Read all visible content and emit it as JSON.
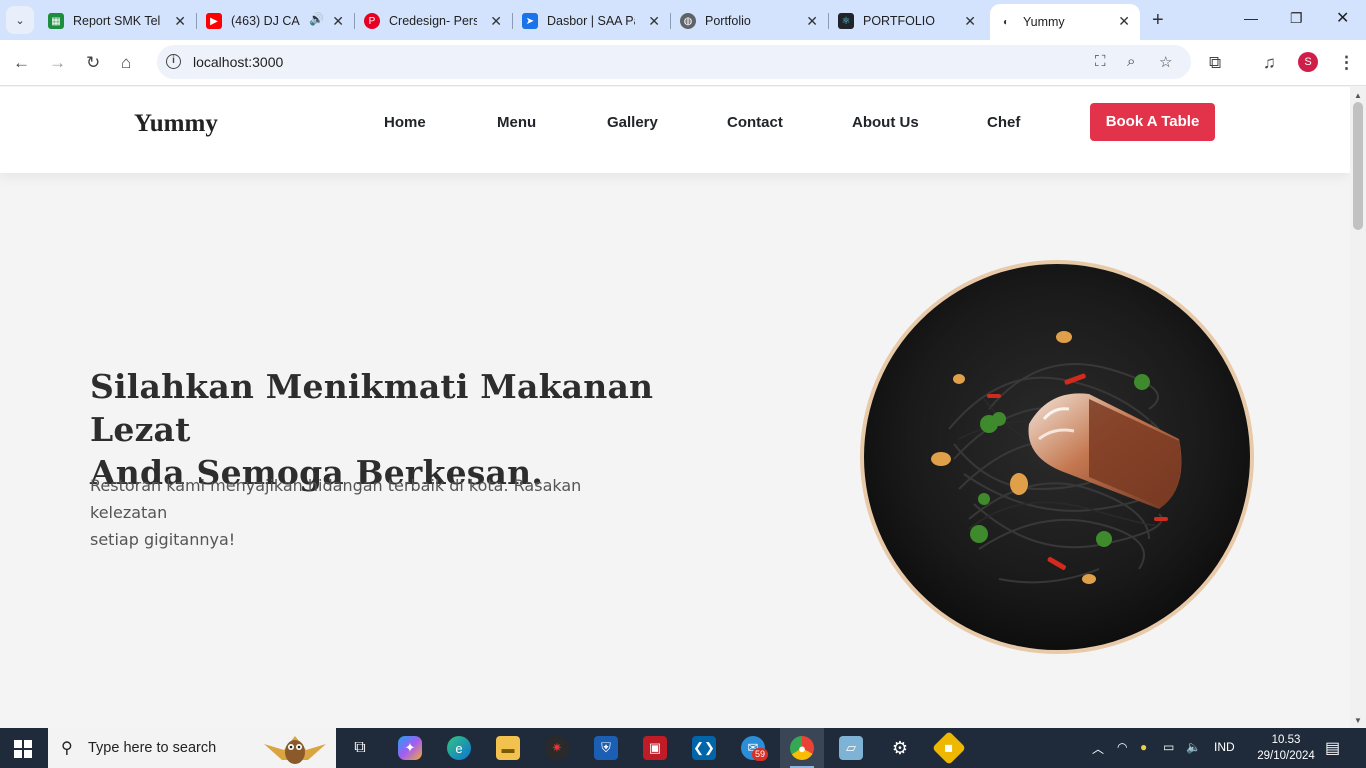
{
  "browser": {
    "tabs": [
      {
        "title": "Report SMK Telk",
        "icon": "sheets-icon"
      },
      {
        "title": "(463) DJ CA",
        "icon": "youtube-icon"
      },
      {
        "title": "Credesign- Pers",
        "icon": "pinterest-icon"
      },
      {
        "title": "Dasbor | SAA Pa",
        "icon": "dasbor-icon"
      },
      {
        "title": "Portfolio",
        "icon": "globe-icon"
      },
      {
        "title": "PORTFOLIO",
        "icon": "react-icon"
      },
      {
        "title": "Yummy",
        "icon": "yummy-icon",
        "active": true
      }
    ],
    "url": "localhost:3000",
    "profile_initial": "S"
  },
  "site": {
    "logo": "Yummy",
    "nav": [
      "Home",
      "Menu",
      "Gallery",
      "Contact",
      "About Us",
      "Chef"
    ],
    "cta": "Book A Table",
    "accent_color": "#e3334a"
  },
  "hero": {
    "title_line1": "Silahkan Menikmati Makanan Lezat",
    "title_line2": "Anda Semoga Berkesan.",
    "subtitle_line1": "Restoran kami menyajikan hidangan terbaik di kota. Rasakan kelezatan",
    "subtitle_line2": "setiap gigitannya!"
  },
  "taskbar": {
    "search_placeholder": "Type here to search",
    "badge": "59",
    "language": "IND",
    "time": "10.53",
    "date": "29/10/2024"
  }
}
